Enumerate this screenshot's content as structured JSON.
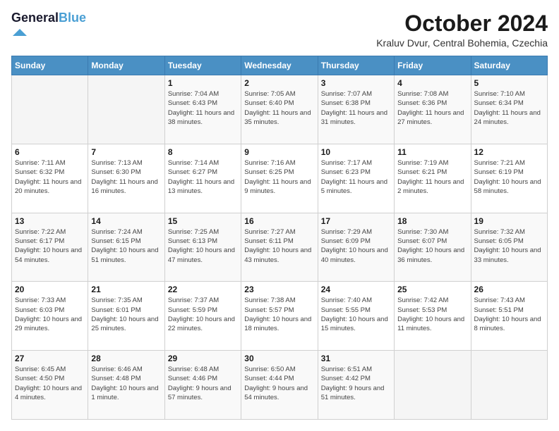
{
  "logo": {
    "blue": "Blue"
  },
  "header": {
    "title": "October 2024",
    "location": "Kraluv Dvur, Central Bohemia, Czechia"
  },
  "days": [
    "Sunday",
    "Monday",
    "Tuesday",
    "Wednesday",
    "Thursday",
    "Friday",
    "Saturday"
  ],
  "weeks": [
    [
      {
        "day": "",
        "info": ""
      },
      {
        "day": "",
        "info": ""
      },
      {
        "day": "1",
        "info": "Sunrise: 7:04 AM\nSunset: 6:43 PM\nDaylight: 11 hours and 38 minutes."
      },
      {
        "day": "2",
        "info": "Sunrise: 7:05 AM\nSunset: 6:40 PM\nDaylight: 11 hours and 35 minutes."
      },
      {
        "day": "3",
        "info": "Sunrise: 7:07 AM\nSunset: 6:38 PM\nDaylight: 11 hours and 31 minutes."
      },
      {
        "day": "4",
        "info": "Sunrise: 7:08 AM\nSunset: 6:36 PM\nDaylight: 11 hours and 27 minutes."
      },
      {
        "day": "5",
        "info": "Sunrise: 7:10 AM\nSunset: 6:34 PM\nDaylight: 11 hours and 24 minutes."
      }
    ],
    [
      {
        "day": "6",
        "info": "Sunrise: 7:11 AM\nSunset: 6:32 PM\nDaylight: 11 hours and 20 minutes."
      },
      {
        "day": "7",
        "info": "Sunrise: 7:13 AM\nSunset: 6:30 PM\nDaylight: 11 hours and 16 minutes."
      },
      {
        "day": "8",
        "info": "Sunrise: 7:14 AM\nSunset: 6:27 PM\nDaylight: 11 hours and 13 minutes."
      },
      {
        "day": "9",
        "info": "Sunrise: 7:16 AM\nSunset: 6:25 PM\nDaylight: 11 hours and 9 minutes."
      },
      {
        "day": "10",
        "info": "Sunrise: 7:17 AM\nSunset: 6:23 PM\nDaylight: 11 hours and 5 minutes."
      },
      {
        "day": "11",
        "info": "Sunrise: 7:19 AM\nSunset: 6:21 PM\nDaylight: 11 hours and 2 minutes."
      },
      {
        "day": "12",
        "info": "Sunrise: 7:21 AM\nSunset: 6:19 PM\nDaylight: 10 hours and 58 minutes."
      }
    ],
    [
      {
        "day": "13",
        "info": "Sunrise: 7:22 AM\nSunset: 6:17 PM\nDaylight: 10 hours and 54 minutes."
      },
      {
        "day": "14",
        "info": "Sunrise: 7:24 AM\nSunset: 6:15 PM\nDaylight: 10 hours and 51 minutes."
      },
      {
        "day": "15",
        "info": "Sunrise: 7:25 AM\nSunset: 6:13 PM\nDaylight: 10 hours and 47 minutes."
      },
      {
        "day": "16",
        "info": "Sunrise: 7:27 AM\nSunset: 6:11 PM\nDaylight: 10 hours and 43 minutes."
      },
      {
        "day": "17",
        "info": "Sunrise: 7:29 AM\nSunset: 6:09 PM\nDaylight: 10 hours and 40 minutes."
      },
      {
        "day": "18",
        "info": "Sunrise: 7:30 AM\nSunset: 6:07 PM\nDaylight: 10 hours and 36 minutes."
      },
      {
        "day": "19",
        "info": "Sunrise: 7:32 AM\nSunset: 6:05 PM\nDaylight: 10 hours and 33 minutes."
      }
    ],
    [
      {
        "day": "20",
        "info": "Sunrise: 7:33 AM\nSunset: 6:03 PM\nDaylight: 10 hours and 29 minutes."
      },
      {
        "day": "21",
        "info": "Sunrise: 7:35 AM\nSunset: 6:01 PM\nDaylight: 10 hours and 25 minutes."
      },
      {
        "day": "22",
        "info": "Sunrise: 7:37 AM\nSunset: 5:59 PM\nDaylight: 10 hours and 22 minutes."
      },
      {
        "day": "23",
        "info": "Sunrise: 7:38 AM\nSunset: 5:57 PM\nDaylight: 10 hours and 18 minutes."
      },
      {
        "day": "24",
        "info": "Sunrise: 7:40 AM\nSunset: 5:55 PM\nDaylight: 10 hours and 15 minutes."
      },
      {
        "day": "25",
        "info": "Sunrise: 7:42 AM\nSunset: 5:53 PM\nDaylight: 10 hours and 11 minutes."
      },
      {
        "day": "26",
        "info": "Sunrise: 7:43 AM\nSunset: 5:51 PM\nDaylight: 10 hours and 8 minutes."
      }
    ],
    [
      {
        "day": "27",
        "info": "Sunrise: 6:45 AM\nSunset: 4:50 PM\nDaylight: 10 hours and 4 minutes."
      },
      {
        "day": "28",
        "info": "Sunrise: 6:46 AM\nSunset: 4:48 PM\nDaylight: 10 hours and 1 minute."
      },
      {
        "day": "29",
        "info": "Sunrise: 6:48 AM\nSunset: 4:46 PM\nDaylight: 9 hours and 57 minutes."
      },
      {
        "day": "30",
        "info": "Sunrise: 6:50 AM\nSunset: 4:44 PM\nDaylight: 9 hours and 54 minutes."
      },
      {
        "day": "31",
        "info": "Sunrise: 6:51 AM\nSunset: 4:42 PM\nDaylight: 9 hours and 51 minutes."
      },
      {
        "day": "",
        "info": ""
      },
      {
        "day": "",
        "info": ""
      }
    ]
  ]
}
